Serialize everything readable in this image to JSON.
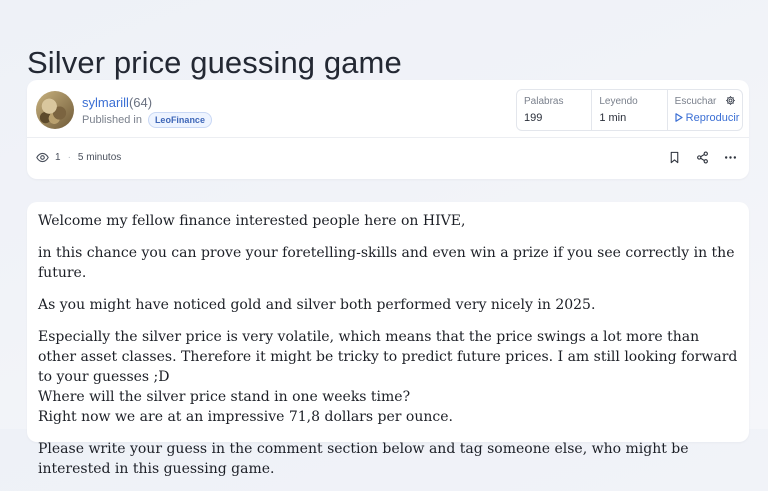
{
  "post": {
    "title": "Silver price guessing game"
  },
  "author": {
    "name": "sylmarill",
    "reputation": "(64)",
    "published_in_label": "Published in",
    "community": "LeoFinance"
  },
  "stats": {
    "words_label": "Palabras",
    "words_value": "199",
    "reading_label": "Leyendo",
    "reading_value": "1 min",
    "listen_label": "Escuchar",
    "listen_value": "Reproducir"
  },
  "engagement": {
    "views": "1",
    "time_ago": "5 minutos"
  },
  "icons": {
    "views": "eye-icon",
    "bookmark": "bookmark-icon",
    "share": "share-icon",
    "more": "more-icon",
    "settings": "gear-icon",
    "play": "play-icon"
  },
  "colors": {
    "link": "#3b6fd4",
    "background": "#f1f3f8",
    "card": "#ffffff"
  },
  "body": {
    "p1": "Welcome my fellow finance interested people here on HIVE,",
    "p2": "in this chance you can prove your foretelling-skills and even win a prize if you see correctly in the future.",
    "p3": "As you might have noticed gold and silver both performed very nicely in 2025.",
    "p4_l1": "Especially the silver price is very volatile, which means that the price swings a lot more than other asset classes. Therefore it might be tricky to predict future prices. I am still looking forward to your guesses ;D",
    "p4_l2": "Where will the silver price stand in one weeks time?",
    "p4_l3": "Right now we are at an impressive 71,8 dollars per ounce.",
    "p5": "Please write your guess in the comment section below and tag someone else, who might be interested in this guessing game."
  }
}
